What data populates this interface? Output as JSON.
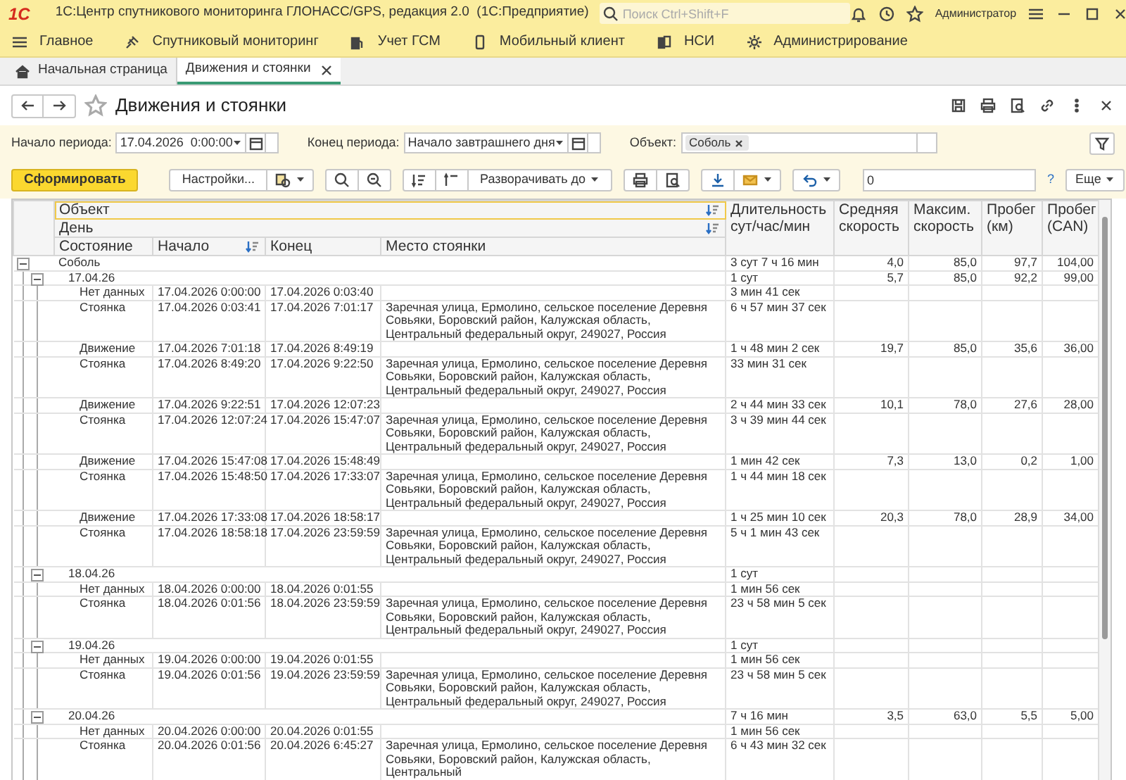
{
  "app": {
    "logo": "1С",
    "title": "1С:Центр спутникового мониторинга ГЛОНАСС/GPS, редакция 2.0  (1С:Предприятие)",
    "search": {
      "placeholder": "Поиск Ctrl+Shift+F"
    },
    "user": "Администратор"
  },
  "menu": [
    "Главное",
    "Спутниковый мониторинг",
    "Учет ГСМ",
    "Мобильный клиент",
    "НСИ",
    "Администрирование"
  ],
  "tabs": [
    {
      "label": "Начальная страница",
      "kind": "home",
      "selected": false,
      "closable": false
    },
    {
      "label": "Движения и стоянки",
      "kind": "page",
      "selected": true,
      "closable": true
    }
  ],
  "form": {
    "title": "Движения и стоянки",
    "favorite": false
  },
  "filters": {
    "period_start": {
      "label": "Начало периода:",
      "value": "17.04.2026  0:00:00"
    },
    "period_end": {
      "label": "Конец периода:",
      "value": "Начало завтрашнего дня"
    },
    "object": {
      "label": "Объект:",
      "tags": [
        "Соболь"
      ]
    }
  },
  "toolbar": {
    "generate": "Сформировать",
    "settings": "Настройки...",
    "expand_to": "Разворачивать до",
    "search_value": "0",
    "help": "?",
    "more": "Еще"
  },
  "report": {
    "header": {
      "object": "Объект",
      "day": "День",
      "state": "Состояние",
      "start": "Начало",
      "end": "Конец",
      "place": "Место стоянки",
      "duration": "Длительность сут/час/мин",
      "avg": "Средняя скорость",
      "max": "Максим. скорость",
      "km": "Пробег (км)",
      "can": "Пробег (CAN)"
    },
    "rows": [
      {
        "label": "Соболь",
        "expanded": true,
        "duration": "3 сут 7 ч 16 мин",
        "avg": "4,0",
        "max": "85,0",
        "km": "97,7",
        "can": "104,00",
        "children": [
          {
            "label": "17.04.26",
            "expanded": true,
            "duration": "1 сут",
            "avg": "5,7",
            "max": "85,0",
            "km": "92,2",
            "can": "99,00",
            "children": [
              {
                "state": "Нет данных",
                "start": "17.04.2026 0:00:00",
                "end": "17.04.2026 0:03:40",
                "duration": "3 мин 41 сек"
              },
              {
                "state": "Стоянка",
                "start": "17.04.2026 0:03:41",
                "end": "17.04.2026 7:01:17",
                "place": "Заречная улица, Ермолино, сельское поселение Деревня Совьяки, Боровский район, Калужская область, Центральный федеральный округ, 249027, Россия",
                "duration": "6 ч 57 мин 37 сек"
              },
              {
                "state": "Движение",
                "start": "17.04.2026 7:01:18",
                "end": "17.04.2026 8:49:19",
                "duration": "1 ч 48 мин 2 сек",
                "avg": "19,7",
                "max": "85,0",
                "km": "35,6",
                "can": "36,00"
              },
              {
                "state": "Стоянка",
                "start": "17.04.2026 8:49:20",
                "end": "17.04.2026 9:22:50",
                "place": "Заречная улица, Ермолино, сельское поселение Деревня Совьяки, Боровский район, Калужская область, Центральный федеральный округ, 249027, Россия",
                "duration": "33 мин 31 сек"
              },
              {
                "state": "Движение",
                "start": "17.04.2026 9:22:51",
                "end": "17.04.2026 12:07:23",
                "duration": "2 ч 44 мин 33 сек",
                "avg": "10,1",
                "max": "78,0",
                "km": "27,6",
                "can": "28,00"
              },
              {
                "state": "Стоянка",
                "start": "17.04.2026 12:07:24",
                "end": "17.04.2026 15:47:07",
                "place": "Заречная улица, Ермолино, сельское поселение Деревня Совьяки, Боровский район, Калужская область, Центральный федеральный округ, 249027, Россия",
                "duration": "3 ч 39 мин 44 сек"
              },
              {
                "state": "Движение",
                "start": "17.04.2026 15:47:08",
                "end": "17.04.2026 15:48:49",
                "duration": "1 мин 42 сек",
                "avg": "7,3",
                "max": "13,0",
                "km": "0,2",
                "can": "1,00"
              },
              {
                "state": "Стоянка",
                "start": "17.04.2026 15:48:50",
                "end": "17.04.2026 17:33:07",
                "place": "Заречная улица, Ермолино, сельское поселение Деревня Совьяки, Боровский район, Калужская область, Центральный федеральный округ, 249027, Россия",
                "duration": "1 ч 44 мин 18 сек"
              },
              {
                "state": "Движение",
                "start": "17.04.2026 17:33:08",
                "end": "17.04.2026 18:58:17",
                "duration": "1 ч 25 мин 10 сек",
                "avg": "20,3",
                "max": "78,0",
                "km": "28,9",
                "can": "34,00"
              },
              {
                "state": "Стоянка",
                "start": "17.04.2026 18:58:18",
                "end": "17.04.2026 23:59:59",
                "place": "Заречная улица, Ермолино, сельское поселение Деревня Совьяки, Боровский район, Калужская область, Центральный федеральный округ, 249027, Россия",
                "duration": "5 ч 1 мин 43 сек"
              }
            ]
          },
          {
            "label": "18.04.26",
            "expanded": true,
            "duration": "1 сут",
            "children": [
              {
                "state": "Нет данных",
                "start": "18.04.2026 0:00:00",
                "end": "18.04.2026 0:01:55",
                "duration": "1 мин 56 сек"
              },
              {
                "state": "Стоянка",
                "start": "18.04.2026 0:01:56",
                "end": "18.04.2026 23:59:59",
                "place": "Заречная улица, Ермолино, сельское поселение Деревня Совьяки, Боровский район, Калужская область, Центральный федеральный округ, 249027, Россия",
                "duration": "23 ч 58 мин 5 сек"
              }
            ]
          },
          {
            "label": "19.04.26",
            "expanded": true,
            "duration": "1 сут",
            "children": [
              {
                "state": "Нет данных",
                "start": "19.04.2026 0:00:00",
                "end": "19.04.2026 0:01:55",
                "duration": "1 мин 56 сек"
              },
              {
                "state": "Стоянка",
                "start": "19.04.2026 0:01:56",
                "end": "19.04.2026 23:59:59",
                "place": "Заречная улица, Ермолино, сельское поселение Деревня Совьяки, Боровский район, Калужская область, Центральный федеральный округ, 249027, Россия",
                "duration": "23 ч 58 мин 5 сек"
              }
            ]
          },
          {
            "label": "20.04.26",
            "expanded": true,
            "duration": "7 ч 16 мин",
            "avg": "3,5",
            "max": "63,0",
            "km": "5,5",
            "can": "5,00",
            "children": [
              {
                "state": "Нет данных",
                "start": "20.04.2026 0:00:00",
                "end": "20.04.2026 0:01:55",
                "duration": "1 мин 56 сек"
              },
              {
                "state": "Стоянка",
                "start": "20.04.2026 0:01:56",
                "end": "20.04.2026 6:45:27",
                "place": "Заречная улица, Ермолино, сельское поселение Деревня Совьяки, Боровский район, Калужская область, Центральный",
                "duration": "6 ч 43 мин 32 сек"
              }
            ]
          }
        ]
      }
    ]
  }
}
